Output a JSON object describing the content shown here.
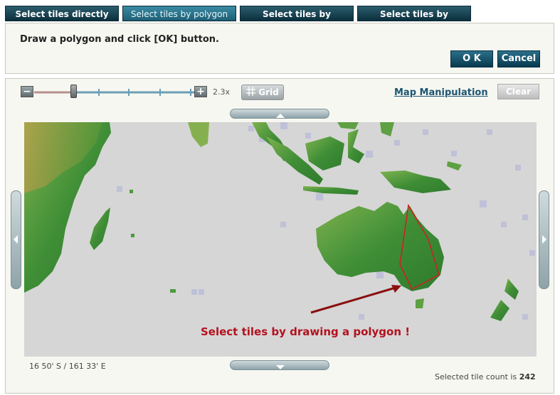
{
  "tabs": [
    {
      "label": "Select tiles directly"
    },
    {
      "label": "Select tiles by polygon"
    },
    {
      "label": "Select tiles by shapefile"
    },
    {
      "label": "Select tiles by coordinate"
    }
  ],
  "instruction": {
    "text": "Draw a polygon and click [OK] button.",
    "ok_label": "O K",
    "cancel_label": "Cancel"
  },
  "toolbar": {
    "zoom_minus": "−",
    "zoom_plus": "+",
    "zoom_value": "2.3x",
    "grid_label": "Grid",
    "map_manipulation": "Map Manipulation",
    "clear_label": "Clear"
  },
  "map": {
    "annotation": "Select tiles by drawing a polygon !",
    "coordinates": "16 50' S /  161 33' E"
  },
  "status": {
    "tile_count_prefix": "Selected tile count is ",
    "tile_count": "242"
  },
  "colors": {
    "tab_dark": "#0b2f3d",
    "tab_active": "#1c5f75",
    "annotation_red": "#b3121e",
    "polygon_red": "#d21e1e",
    "land_green": "#4e9a3c",
    "sea_gray": "#d6d6d6"
  },
  "icons": {
    "grid": "grid-icon",
    "pan_up": "chevron-up-icon",
    "pan_down": "chevron-down-icon",
    "pan_left": "chevron-left-icon",
    "pan_right": "chevron-right-icon"
  }
}
